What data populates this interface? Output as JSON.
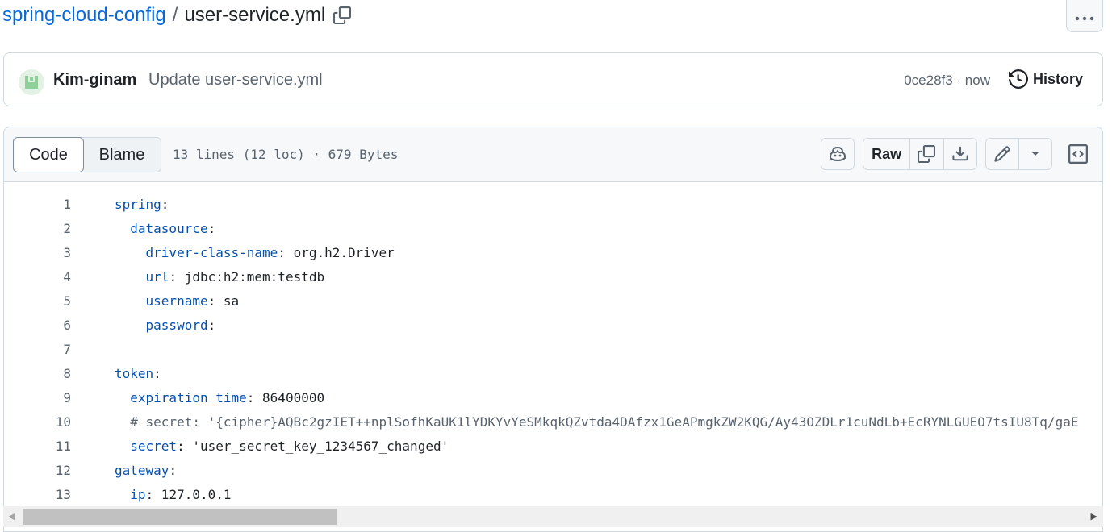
{
  "breadcrumb": {
    "repo": "spring-cloud-config",
    "separator": "/",
    "file": "user-service.yml"
  },
  "commit": {
    "author": "Kim-ginam",
    "message": "Update user-service.yml",
    "meta": "0ce28f3 · now",
    "history_label": "History"
  },
  "file_header": {
    "tabs": [
      {
        "label": "Code",
        "selected": true
      },
      {
        "label": "Blame",
        "selected": false
      }
    ],
    "info": "13 lines (12 loc) · 679 Bytes",
    "raw_label": "Raw"
  },
  "code": {
    "lines": [
      {
        "num": "1",
        "indent": "",
        "key": "spring",
        "sep": ":",
        "value": "",
        "comment": ""
      },
      {
        "num": "2",
        "indent": "  ",
        "key": "datasource",
        "sep": ":",
        "value": "",
        "comment": ""
      },
      {
        "num": "3",
        "indent": "    ",
        "key": "driver-class-name",
        "sep": ":",
        "value": " org.h2.Driver",
        "comment": ""
      },
      {
        "num": "4",
        "indent": "    ",
        "key": "url",
        "sep": ":",
        "value": " jdbc:h2:mem:testdb",
        "comment": ""
      },
      {
        "num": "5",
        "indent": "    ",
        "key": "username",
        "sep": ":",
        "value": " sa",
        "comment": ""
      },
      {
        "num": "6",
        "indent": "    ",
        "key": "password",
        "sep": ":",
        "value": "",
        "comment": ""
      },
      {
        "num": "7",
        "indent": "",
        "key": "",
        "sep": "",
        "value": "",
        "comment": ""
      },
      {
        "num": "8",
        "indent": "",
        "key": "token",
        "sep": ":",
        "value": "",
        "comment": ""
      },
      {
        "num": "9",
        "indent": "  ",
        "key": "expiration_time",
        "sep": ":",
        "value": " 86400000",
        "comment": ""
      },
      {
        "num": "10",
        "indent": "  ",
        "key": "",
        "sep": "",
        "value": "",
        "comment": "# secret: '{cipher}AQBc2gzIET++nplSofhKaUK1lYDKYvYeSMkqkQZvtda4DAfzx1GeAPmgkZW2KQG/Ay43OZDLr1cuNdLb+EcRYNLGUEO7tsIU8Tq/gaE"
      },
      {
        "num": "11",
        "indent": "  ",
        "key": "secret",
        "sep": ":",
        "value": " 'user_secret_key_1234567_changed'",
        "comment": ""
      },
      {
        "num": "12",
        "indent": "",
        "key": "gateway",
        "sep": ":",
        "value": "",
        "comment": ""
      },
      {
        "num": "13",
        "indent": "  ",
        "key": "ip",
        "sep": ":",
        "value": " 127.0.0.1",
        "comment": ""
      }
    ]
  },
  "icons": {
    "copy_path": "copy-icon",
    "more": "kebab-horizontal-icon",
    "history": "history-icon",
    "copilot": "copilot-icon",
    "copy_raw": "copy-icon",
    "download": "download-icon",
    "edit": "pencil-icon",
    "dropdown": "triangle-down-icon",
    "symbols": "code-square-icon"
  },
  "colors": {
    "link": "#0969da",
    "yaml_key": "#0550ae",
    "muted": "#59636e"
  }
}
